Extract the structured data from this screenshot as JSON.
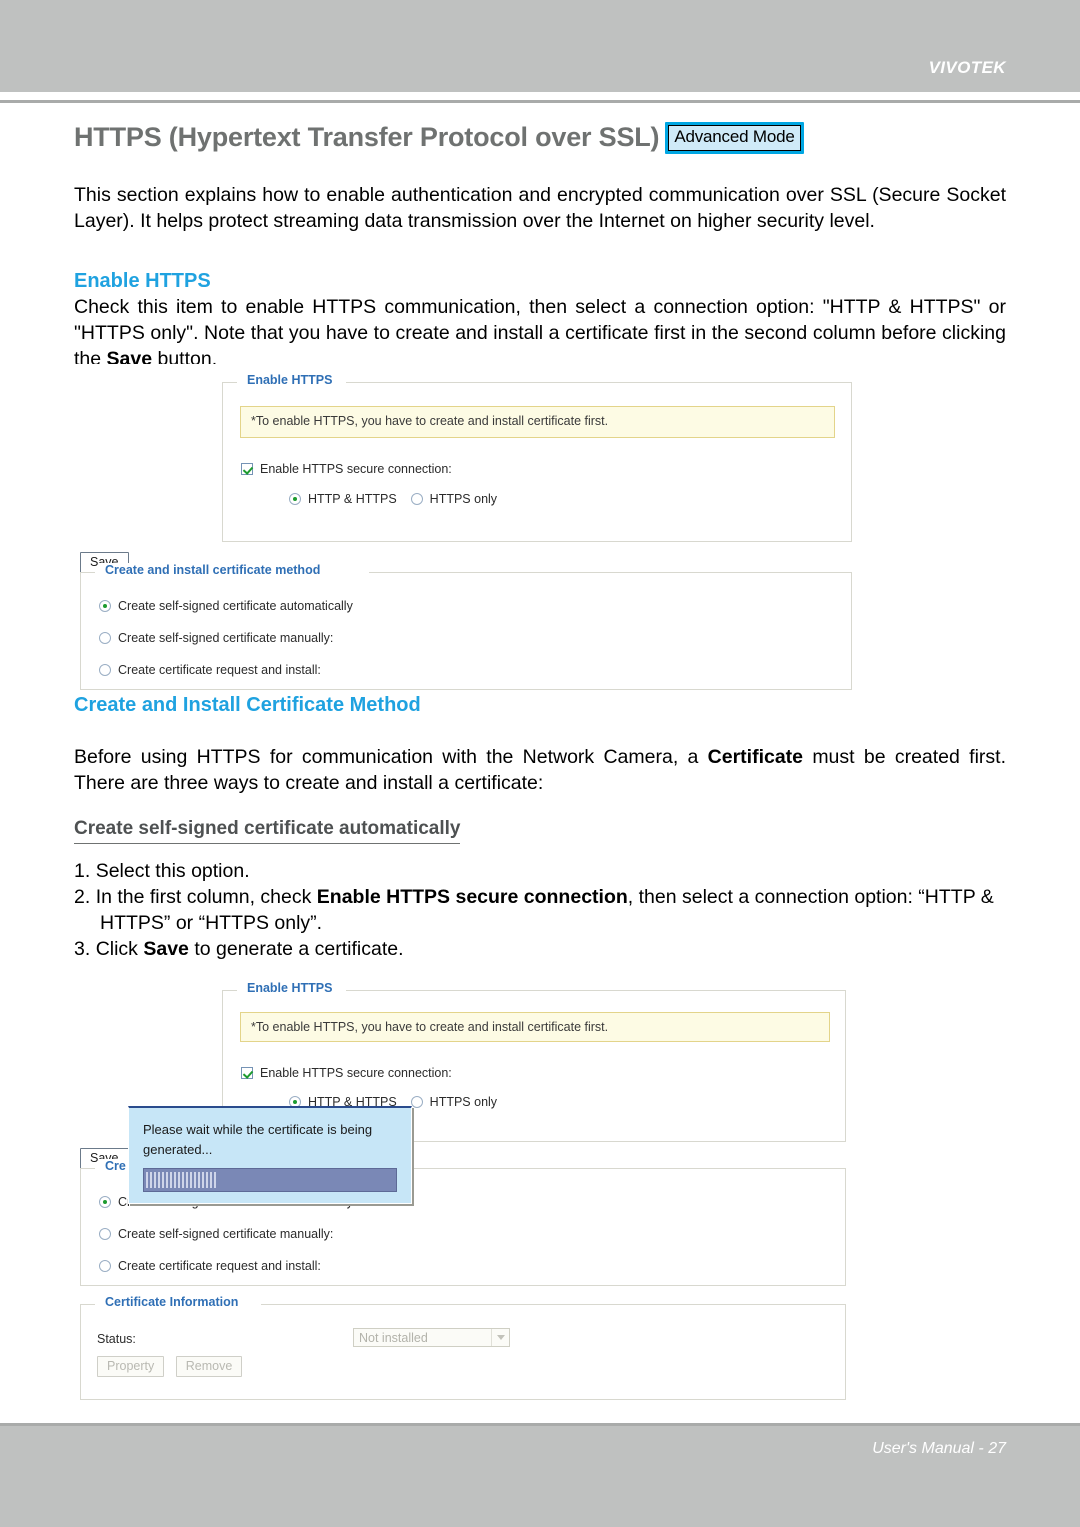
{
  "header": {
    "brand": "VIVOTEK"
  },
  "footer": {
    "text": "User's Manual - 27"
  },
  "page": {
    "title": "HTTPS (Hypertext Transfer Protocol over SSL)",
    "advanced_mode_badge": "Advanced Mode",
    "intro": "This section explains how to enable authentication and encrypted communication over SSL (Secure Socket Layer). It helps protect streaming data transmission over the Internet on higher security level."
  },
  "enable_https_section": {
    "heading": "Enable HTTPS",
    "paragraph": "Check this item to enable HTTPS communication, then select a connection option: \"HTTP & HTTPS\" or \"HTTPS only\". Note that you have to create and install a certificate first in the second column before clicking the Save button.",
    "paragraph_bold_word": "Save"
  },
  "create_install_section": {
    "heading": "Create and Install Certificate Method",
    "paragraph_part1": "Before using HTTPS for communication with the Network Camera, a ",
    "paragraph_bold": "Certificate",
    "paragraph_part2": " must be created first. There are three ways to create and install a certificate:",
    "subheading": "Create self-signed certificate automatically",
    "steps": [
      {
        "number": "1.",
        "text_part1": "Select this option.",
        "bold": "",
        "text_part2": ""
      },
      {
        "number": "2.",
        "text_part1": "In the first column, check ",
        "bold": "Enable HTTPS secure connection",
        "text_part2": ", then select a connection option: “HTTP & HTTPS” or “HTTPS only”."
      },
      {
        "number": "3.",
        "text_part1": "Click ",
        "bold": "Save",
        "text_part2": " to generate a certificate."
      }
    ]
  },
  "screenshot_one": {
    "enable_https_panel": {
      "legend": "Enable HTTPS",
      "notice": "*To enable HTTPS, you have to create and install certificate first.",
      "checkbox_label": "Enable HTTPS secure connection:",
      "checkbox_checked": true,
      "radios": [
        {
          "label": "HTTP & HTTPS",
          "selected": true
        },
        {
          "label": "HTTPS only",
          "selected": false
        }
      ]
    },
    "save_button": "Save",
    "certificate_method_panel": {
      "legend": "Create and install certificate method",
      "radios": [
        {
          "label": "Create self-signed certificate automatically",
          "selected": true
        },
        {
          "label": "Create self-signed certificate manually:",
          "selected": false
        },
        {
          "label": "Create certificate request and install:",
          "selected": false
        }
      ]
    }
  },
  "screenshot_two": {
    "enable_https_panel": {
      "legend": "Enable HTTPS",
      "notice": "*To enable HTTPS, you have to create and install certificate first.",
      "checkbox_label": "Enable HTTPS secure connection:",
      "checkbox_checked": true,
      "radios": [
        {
          "label": "HTTP & HTTPS",
          "selected": true
        },
        {
          "label": "HTTPS only",
          "selected": false
        }
      ]
    },
    "save_button": "Save",
    "certificate_method_panel": {
      "legend": "Cre",
      "legend_full": "Create and install certificate method",
      "radios": [
        {
          "label": "Create self-signed certificate automatically",
          "selected": true
        },
        {
          "label": "Create self-signed certificate manually:",
          "selected": false
        },
        {
          "label": "Create certificate request and install:",
          "selected": false
        }
      ]
    },
    "progress_dialog": {
      "message_line1": "Please wait while the certificate is being",
      "message_line2": "generated...",
      "progress_indeterminate": true
    },
    "certificate_information_panel": {
      "legend": "Certificate Information",
      "status_label": "Status:",
      "status_value": "Not installed",
      "buttons": [
        {
          "label": "Property",
          "disabled": true
        },
        {
          "label": "Remove",
          "disabled": true
        }
      ]
    }
  },
  "colors": {
    "brand_bar": "#bfc1c0",
    "accent_blue": "#1fa2e0",
    "badge_border": "#00a6e2",
    "badge_fill": "#cfeaf8",
    "legend_blue": "#2f6fb5",
    "notice_bg": "#fdfbe4",
    "notice_border": "#e3d48a",
    "dialog_bg": "#c7e6f7",
    "progress_bar": "#7a88b6"
  }
}
